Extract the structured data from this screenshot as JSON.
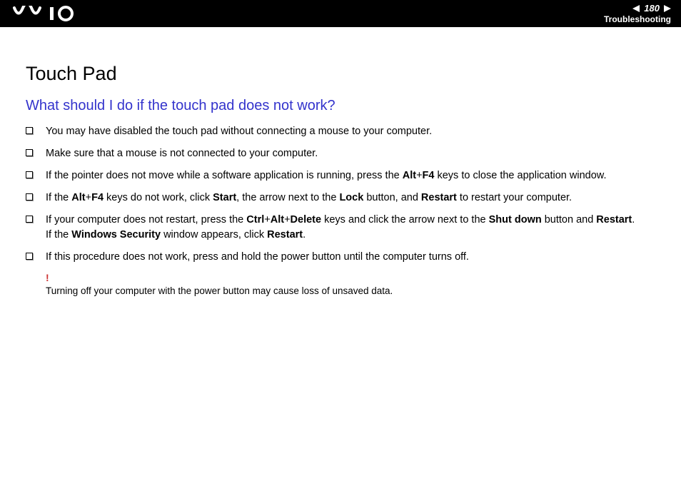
{
  "header": {
    "page_number": "180",
    "section": "Troubleshooting"
  },
  "content": {
    "title": "Touch Pad",
    "question": "What should I do if the touch pad does not work?",
    "bullets": [
      {
        "html": "You may have disabled the touch pad without connecting a mouse to your computer."
      },
      {
        "html": "Make sure that a mouse is not connected to your computer."
      },
      {
        "html": "If the pointer does not move while a software application is running, press the <b>Alt</b>+<b>F4</b> keys to close the application window."
      },
      {
        "html": "If the <b>Alt</b>+<b>F4</b> keys do not work, click <b>Start</b>, the arrow next to the <b>Lock</b> button, and <b>Restart</b> to restart your computer."
      },
      {
        "html": "If your computer does not restart, press the <b>Ctrl</b>+<b>Alt</b>+<b>Delete</b> keys and click the arrow next to the <b>Shut down</b> button and <b>Restart</b>.<br>If the <b>Windows Security</b> window appears, click <b>Restart</b>."
      },
      {
        "html": "If this procedure does not work, press and hold the power button until the computer turns off."
      }
    ],
    "warning_mark": "!",
    "warning_text": "Turning off your computer with the power button may cause loss of unsaved data."
  }
}
